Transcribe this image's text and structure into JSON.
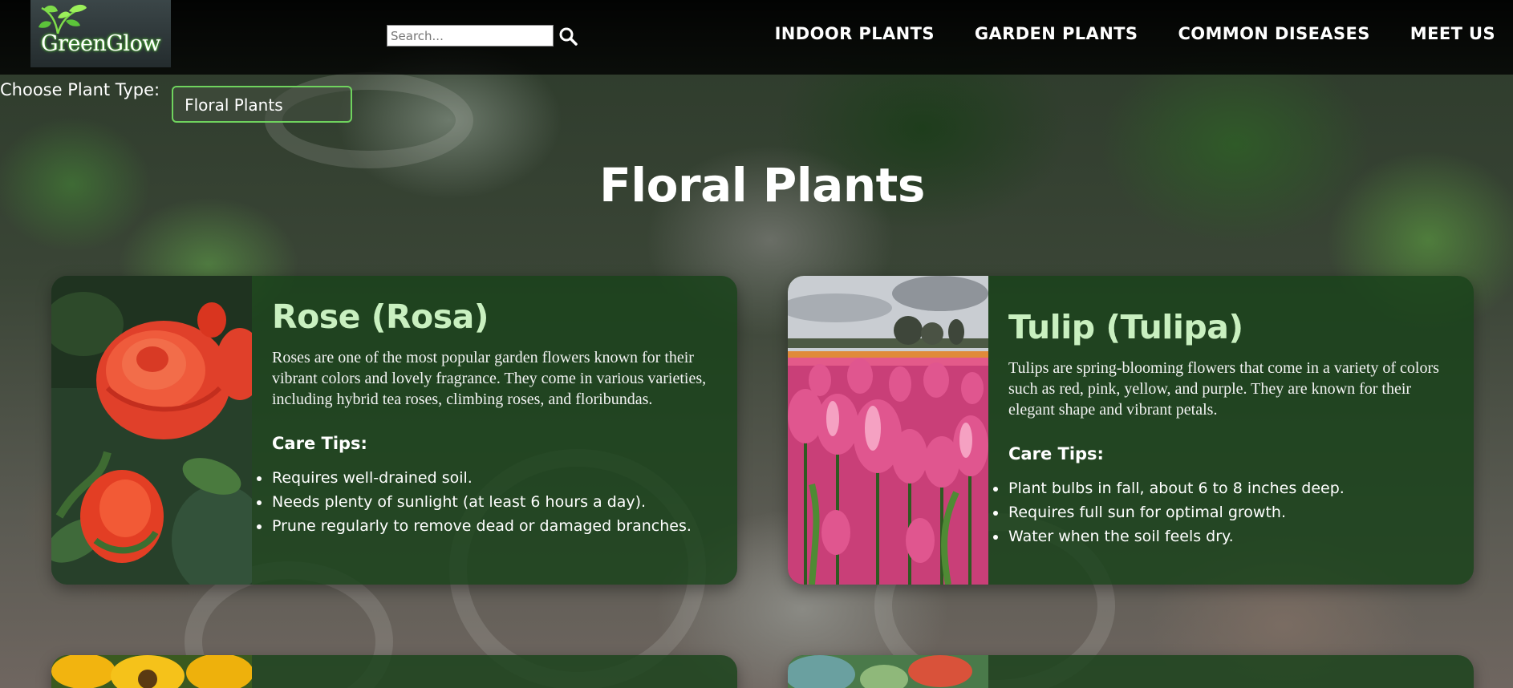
{
  "brand": {
    "name": "GreenGlow"
  },
  "search": {
    "placeholder": "Search...",
    "icon": "search-icon"
  },
  "nav": [
    {
      "label": "INDOOR PLANTS"
    },
    {
      "label": "GARDEN PLANTS"
    },
    {
      "label": "COMMON DISEASES"
    },
    {
      "label": "MEET US"
    }
  ],
  "chooser": {
    "label": "Choose Plant Type:",
    "selected": "Floral Plants"
  },
  "page": {
    "title": "Floral Plants"
  },
  "cards": [
    {
      "title": "Rose (Rosa)",
      "description": "Roses are one of the most popular garden flowers known for their vibrant colors and lovely fragrance. They come in various varieties, including hybrid tea roses, climbing roses, and floribundas.",
      "care_heading": "Care Tips:",
      "care_tips": [
        "Requires well-drained soil.",
        "Needs plenty of sunlight (at least 6 hours a day).",
        "Prune regularly to remove dead or damaged branches."
      ]
    },
    {
      "title": "Tulip (Tulipa)",
      "description": "Tulips are spring-blooming flowers that come in a variety of colors such as red, pink, yellow, and purple. They are known for their elegant shape and vibrant petals.",
      "care_heading": "Care Tips:",
      "care_tips": [
        "Plant bulbs in fall, about 6 to 8 inches deep.",
        "Requires full sun for optimal growth.",
        "Water when the soil feels dry."
      ]
    }
  ],
  "colors": {
    "accent_green": "#6fd35e",
    "card_background": "#18421a",
    "card_title": "#c9f0c0"
  }
}
